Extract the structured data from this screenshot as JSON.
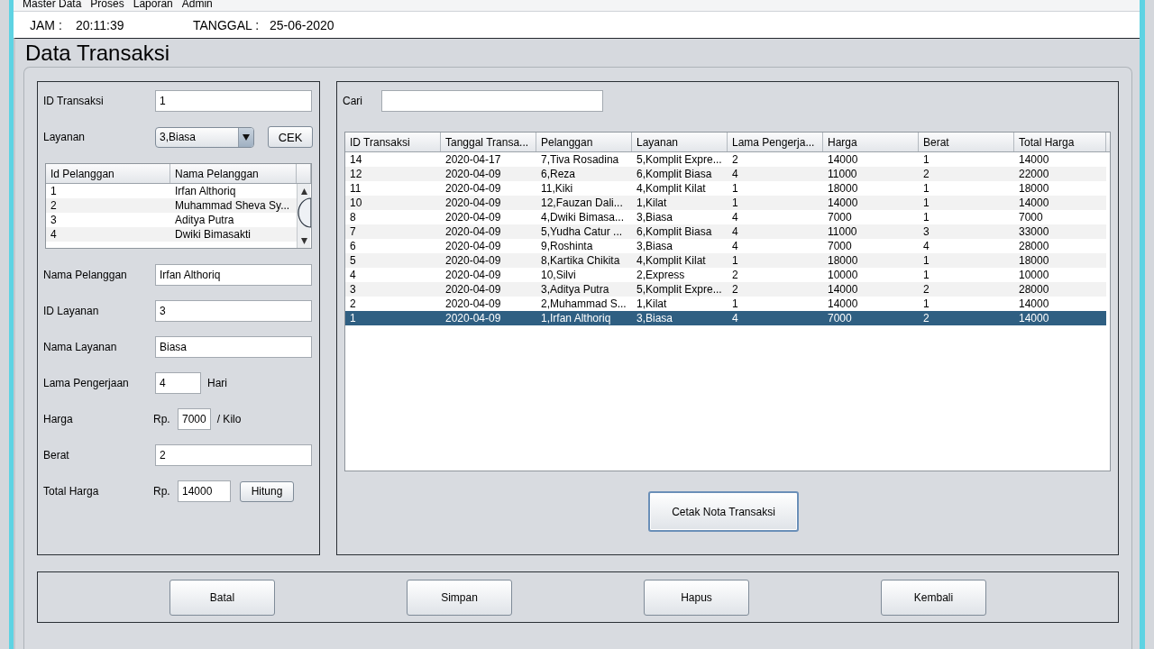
{
  "menu": [
    "Master Data",
    "Proses",
    "Laporan",
    "Admin"
  ],
  "clock": {
    "time_label": "JAM :",
    "time": "20:11:39",
    "date_label": "TANGGAL :",
    "date": "25-06-2020"
  },
  "title": "Data Transaksi",
  "form": [
    {
      "kind": "text",
      "label": "ID Transaksi",
      "value": "1"
    },
    {
      "kind": "combo",
      "label": "Layanan",
      "value": "3,Biasa",
      "button": "CEK"
    },
    {
      "kind": "table",
      "columns": [
        "Id Pelanggan",
        "Nama Pelanggan"
      ],
      "rows": [
        [
          "1",
          "Irfan Althoriq"
        ],
        [
          "2",
          "Muhammad Sheva Sy..."
        ],
        [
          "3",
          "Aditya Putra"
        ],
        [
          "4",
          "Dwiki Bimasakti"
        ]
      ]
    },
    {
      "kind": "text",
      "label": "Nama Pelanggan",
      "value": "Irfan Althoriq"
    },
    {
      "kind": "text",
      "label": "ID Layanan",
      "value": "3"
    },
    {
      "kind": "text",
      "label": "Nama Layanan",
      "value": "Biasa"
    },
    {
      "kind": "unit",
      "label": "Lama Pengerjaan",
      "value": "4",
      "unit": "Hari"
    },
    {
      "kind": "price",
      "label": "Harga",
      "prefix": "Rp.",
      "value": "7000",
      "unit": "/ Kilo"
    },
    {
      "kind": "text",
      "label": "Berat",
      "value": "2"
    },
    {
      "kind": "total",
      "label": "Total Harga",
      "prefix": "Rp.",
      "value": "14000",
      "button": "Hitung"
    }
  ],
  "search": {
    "label": "Cari"
  },
  "table": {
    "columns": [
      "ID Transaksi",
      "Tanggal Transa...",
      "Pelanggan",
      "Layanan",
      "Lama Pengerja...",
      "Harga",
      "Berat",
      "Total Harga"
    ],
    "rows": [
      {
        "cells": [
          "14",
          "2020-04-17",
          "7,Tiva Rosadina",
          "5,Komplit Expre...",
          "2",
          "14000",
          "1",
          "14000"
        ],
        "selected": false
      },
      {
        "cells": [
          "12",
          "2020-04-09",
          "6,Reza",
          "6,Komplit Biasa",
          "4",
          "11000",
          "2",
          "22000"
        ],
        "selected": false
      },
      {
        "cells": [
          "11",
          "2020-04-09",
          "11,Kiki",
          "4,Komplit Kilat",
          "1",
          "18000",
          "1",
          "18000"
        ],
        "selected": false
      },
      {
        "cells": [
          "10",
          "2020-04-09",
          "12,Fauzan Dali...",
          "1,Kilat",
          "1",
          "14000",
          "1",
          "14000"
        ],
        "selected": false
      },
      {
        "cells": [
          "8",
          "2020-04-09",
          "4,Dwiki Bimasa...",
          "3,Biasa",
          "4",
          "7000",
          "1",
          "7000"
        ],
        "selected": false
      },
      {
        "cells": [
          "7",
          "2020-04-09",
          "5,Yudha Catur ...",
          "6,Komplit Biasa",
          "4",
          "11000",
          "3",
          "33000"
        ],
        "selected": false
      },
      {
        "cells": [
          "6",
          "2020-04-09",
          "9,Roshinta",
          "3,Biasa",
          "4",
          "7000",
          "4",
          "28000"
        ],
        "selected": false
      },
      {
        "cells": [
          "5",
          "2020-04-09",
          "8,Kartika Chikita",
          "4,Komplit Kilat",
          "1",
          "18000",
          "1",
          "18000"
        ],
        "selected": false
      },
      {
        "cells": [
          "4",
          "2020-04-09",
          "10,Silvi",
          "2,Express",
          "2",
          "10000",
          "1",
          "10000"
        ],
        "selected": false
      },
      {
        "cells": [
          "3",
          "2020-04-09",
          "3,Aditya Putra",
          "5,Komplit Expre...",
          "2",
          "14000",
          "2",
          "28000"
        ],
        "selected": false
      },
      {
        "cells": [
          "2",
          "2020-04-09",
          "2,Muhammad S...",
          "1,Kilat",
          "1",
          "14000",
          "1",
          "14000"
        ],
        "selected": false
      },
      {
        "cells": [
          "1",
          "2020-04-09",
          "1,Irfan Althoriq",
          "3,Biasa",
          "4",
          "7000",
          "2",
          "14000"
        ],
        "selected": true
      }
    ]
  },
  "print_button": {
    "label": "Cetak Nota Transaksi",
    "focused": true
  },
  "buttons": [
    "Batal",
    "Simpan",
    "Hapus",
    "Kembali"
  ]
}
